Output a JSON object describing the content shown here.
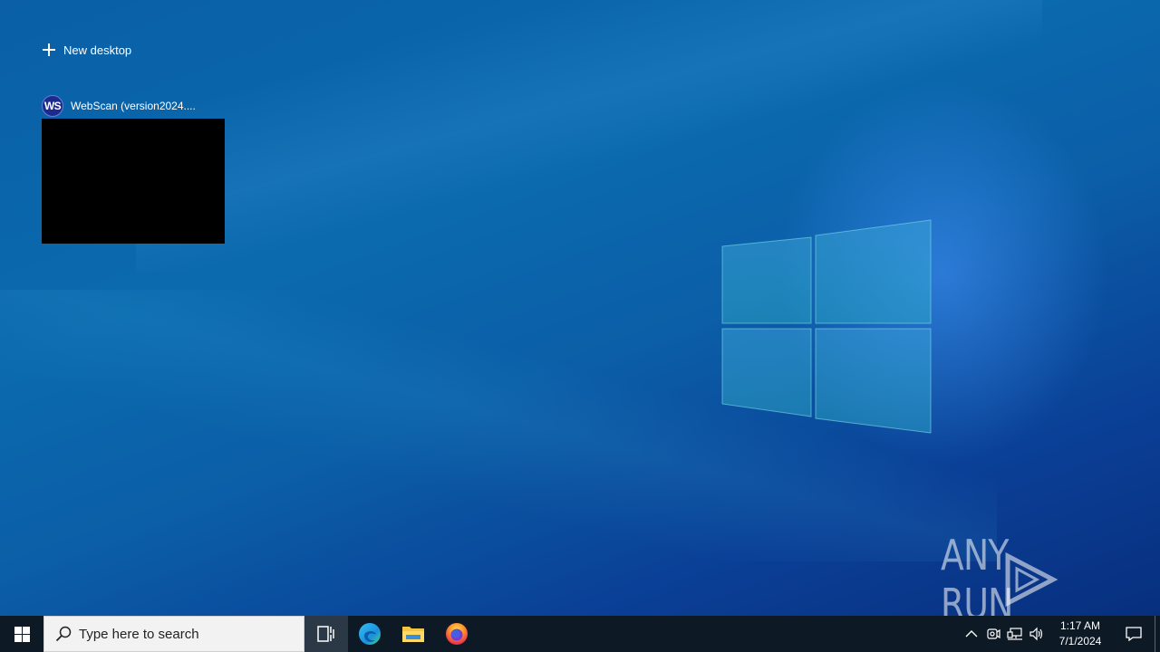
{
  "task_view": {
    "new_desktop_label": "New desktop",
    "windows": [
      {
        "title": "WebScan (version2024....",
        "app_icon_text": "WS",
        "icon": "webscan-app-icon"
      }
    ]
  },
  "watermark": {
    "text": "ANY RUN"
  },
  "taskbar": {
    "search_placeholder": "Type here to search",
    "pinned": [
      {
        "name": "task-view",
        "icon": "task-view-icon",
        "active": true
      },
      {
        "name": "edge",
        "icon": "edge-icon"
      },
      {
        "name": "file-explorer",
        "icon": "folder-icon"
      },
      {
        "name": "firefox",
        "icon": "firefox-icon"
      }
    ],
    "clock": {
      "time": "1:17 AM",
      "date": "7/1/2024"
    }
  },
  "colors": {
    "desktop_blue": "#0b6aae",
    "taskbar": "#0d1a26",
    "app_icon_bg": "#1b2a8c"
  }
}
